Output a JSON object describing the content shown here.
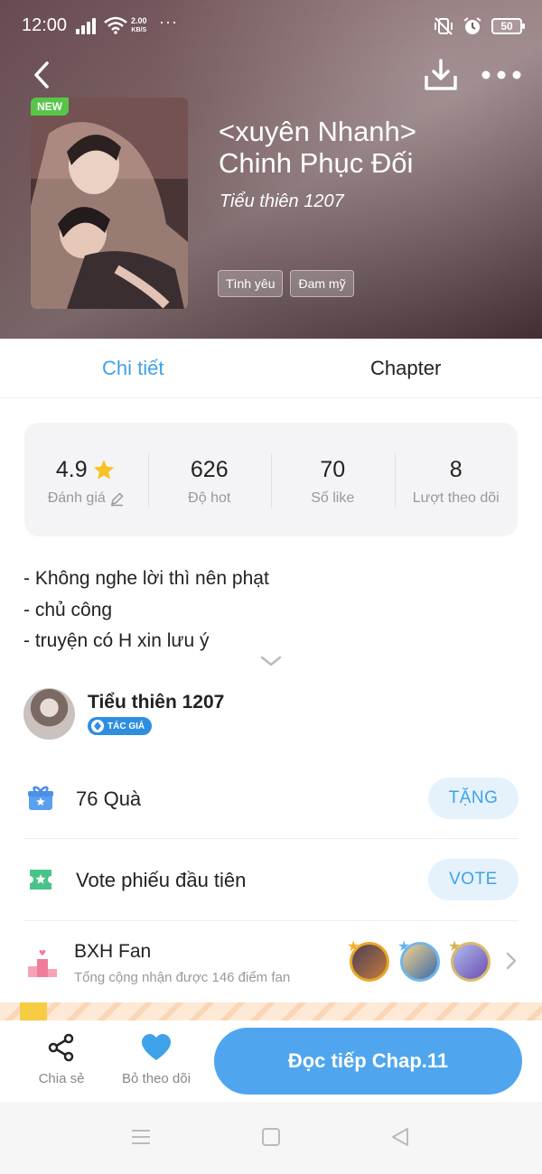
{
  "status_bar": {
    "time": "12:00",
    "net_speed_value": "2.00",
    "net_speed_unit": "KB/S",
    "more": "···",
    "battery": "50"
  },
  "book": {
    "badge": "NEW",
    "title_line1": "<xuyên Nhanh>",
    "title_line2": "Chinh Phục Đối",
    "author": "Tiểu thiên 1207",
    "tags": [
      "Tình yêu",
      "Đam mỹ"
    ]
  },
  "tabs": [
    {
      "label": "Chi tiết",
      "active": true
    },
    {
      "label": "Chapter",
      "active": false
    }
  ],
  "stats": [
    {
      "value": "4.9",
      "label": "Đánh giá"
    },
    {
      "value": "626",
      "label": "Độ hot"
    },
    {
      "value": "70",
      "label": "Số like"
    },
    {
      "value": "8",
      "label": "Lượt theo dõi"
    }
  ],
  "description": [
    "- Không nghe lời thì nên phạt",
    "- chủ công",
    "- truyện có H xin lưu ý"
  ],
  "author_row": {
    "name": "Tiểu thiên 1207",
    "badge": "TÁC GIẢ"
  },
  "gift": {
    "label": "76  Quà",
    "button": "TẶNG"
  },
  "vote": {
    "label": "Vote phiếu đầu tiên",
    "button": "VOTE"
  },
  "fan": {
    "title": "BXH Fan",
    "subtitle": "Tổng cộng nhận được 146 điểm fan"
  },
  "bottom_bar": {
    "share_label": "Chia sẻ",
    "unfollow_label": "Bỏ theo dõi",
    "read_button": "Đọc tiếp Chap.11"
  },
  "colors": {
    "accent": "#3ea2ea",
    "read_button": "#4fa6ee",
    "new_badge": "#58c548",
    "star": "#f7c325"
  },
  "icons": [
    "back-arrow-icon",
    "download-icon",
    "more-dots-icon",
    "star-icon",
    "edit-icon",
    "chevron-down-icon",
    "gift-icon",
    "ticket-icon",
    "podium-icon",
    "chevron-right-icon",
    "share-icon",
    "heart-icon"
  ]
}
